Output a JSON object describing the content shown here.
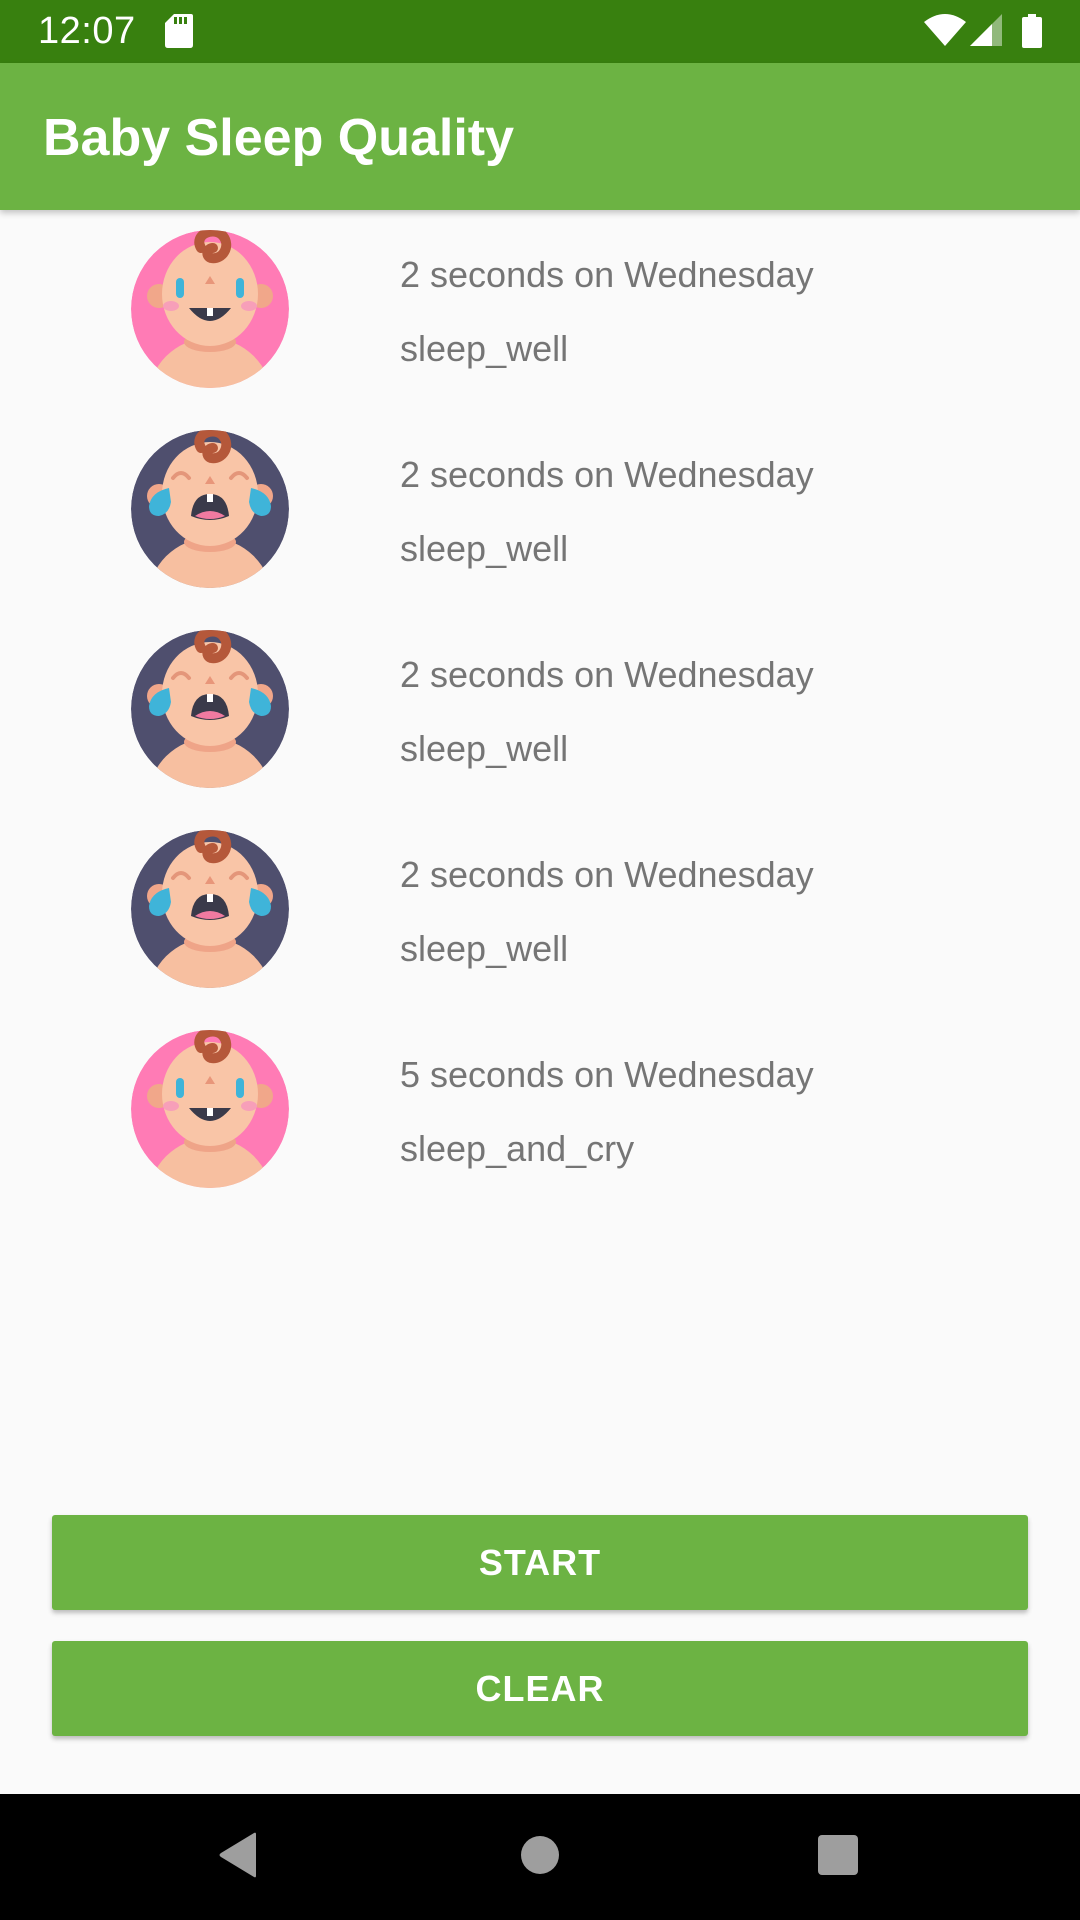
{
  "status_bar": {
    "time": "12:07",
    "icons": [
      "sd-card-icon",
      "wifi-icon",
      "signal-icon",
      "battery-icon"
    ],
    "background": "#38800f"
  },
  "app_bar": {
    "title": "Baby Sleep Quality",
    "background": "#6cb343"
  },
  "sleep_list": {
    "items": [
      {
        "time": "2 seconds on Wednesday",
        "quality": "sleep_well",
        "icon": "happy-baby-icon"
      },
      {
        "time": "2 seconds on Wednesday",
        "quality": "sleep_well",
        "icon": "crying-baby-icon"
      },
      {
        "time": "2 seconds on Wednesday",
        "quality": "sleep_well",
        "icon": "crying-baby-icon"
      },
      {
        "time": "2 seconds on Wednesday",
        "quality": "sleep_well",
        "icon": "crying-baby-icon"
      },
      {
        "time": "5 seconds on Wednesday",
        "quality": "sleep_and_cry",
        "icon": "happy-baby-icon"
      }
    ]
  },
  "buttons": {
    "start_label": "START",
    "clear_label": "CLEAR",
    "color": "#6cb343"
  },
  "nav_bar": {
    "icons": [
      "back-icon",
      "home-icon",
      "recent-apps-icon"
    ]
  }
}
